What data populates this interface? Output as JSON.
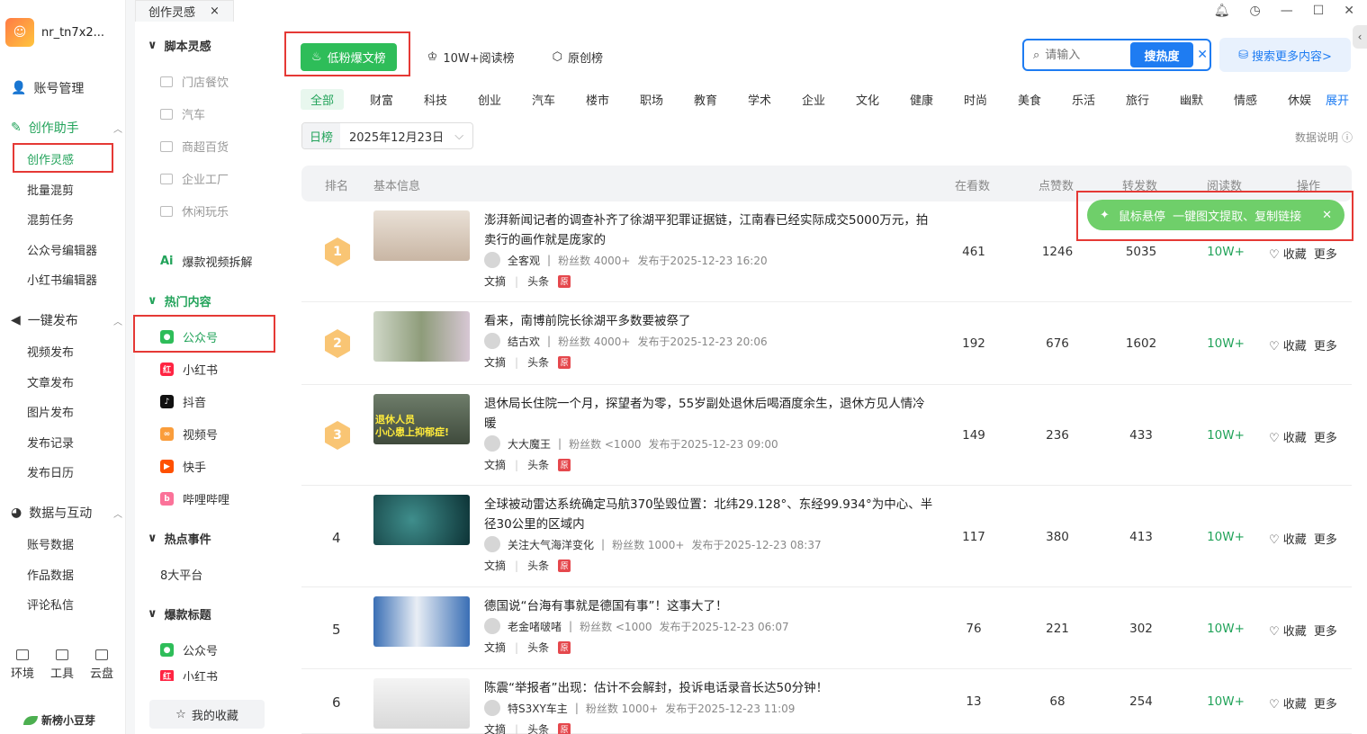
{
  "profile": {
    "name": "nr_tn7x2..."
  },
  "sidebar": {
    "account": "账号管理",
    "creation": {
      "label": "创作助手",
      "items": [
        "创作灵感",
        "批量混剪",
        "混剪任务",
        "公众号编辑器",
        "小红书编辑器"
      ]
    },
    "publish": {
      "label": "一键发布",
      "items": [
        "视频发布",
        "文章发布",
        "图片发布",
        "发布记录",
        "发布日历"
      ]
    },
    "data": {
      "label": "数据与互动",
      "items": [
        "账号数据",
        "作品数据",
        "评论私信"
      ]
    },
    "tools": [
      "环境",
      "工具",
      "云盘"
    ],
    "brand": "新榜小豆芽"
  },
  "col2": {
    "tab": "创作灵感",
    "script": {
      "label": "脚本灵感",
      "items": [
        "门店餐饮",
        "汽车",
        "商超百货",
        "企业工厂",
        "休闲玩乐"
      ]
    },
    "ai": "爆款视频拆解",
    "hot": {
      "label": "热门内容",
      "items": [
        "公众号",
        "小红书",
        "抖音",
        "视频号",
        "快手",
        "哔哩哔哩"
      ]
    },
    "events": {
      "label": "热点事件",
      "items": [
        "8大平台"
      ]
    },
    "titles": {
      "label": "爆款标题",
      "items": [
        "公众号",
        "小红书"
      ]
    },
    "favorites": "我的收藏"
  },
  "rank_tabs": [
    "低粉爆文榜",
    "10W+阅读榜",
    "原创榜"
  ],
  "search": {
    "placeholder": "请输入",
    "button": "搜热度",
    "more": "搜索更多内容>"
  },
  "categories": [
    "全部",
    "财富",
    "科技",
    "创业",
    "汽车",
    "楼市",
    "职场",
    "教育",
    "学术",
    "企业",
    "文化",
    "健康",
    "时尚",
    "美食",
    "乐活",
    "旅行",
    "幽默",
    "情感",
    "休娱"
  ],
  "expand": "展开",
  "date": {
    "label": "日榜",
    "value": "2025年12月23日"
  },
  "data_note": "数据说明",
  "table": {
    "headers": [
      "排名",
      "基本信息",
      "在看数",
      "点赞数",
      "转发数",
      "阅读数",
      "操作"
    ],
    "tag1": "文摘",
    "tag2": "头条",
    "tag3": "原",
    "fav": "收藏",
    "more": "更多",
    "rows": [
      {
        "rank": "1",
        "title": "澎湃新闻记者的调查补齐了徐湖平犯罪证据链，江南春已经实际成交5000万元，拍卖行的画作就是庞家的",
        "author": "全客观",
        "fans": "粉丝数 4000+",
        "time": "发布于2025-12-23 16:20",
        "watch": "461",
        "likes": "1246",
        "shares": "5035",
        "reads": "10W+"
      },
      {
        "rank": "2",
        "title": "看来，南博前院长徐湖平多数要被祭了",
        "author": "结古欢",
        "fans": "粉丝数 4000+",
        "time": "发布于2025-12-23 20:06",
        "watch": "192",
        "likes": "676",
        "shares": "1602",
        "reads": "10W+"
      },
      {
        "rank": "3",
        "title": "退休局长住院一个月，探望者为零，55岁副处退休后喝酒度余生，退休方见人情冷暖",
        "author": "大大魔王",
        "fans": "粉丝数 <1000",
        "time": "发布于2025-12-23 09:00",
        "watch": "149",
        "likes": "236",
        "shares": "433",
        "reads": "10W+"
      },
      {
        "rank": "4",
        "title": "全球被动雷达系统确定马航370坠毁位置：北纬29.128°、东经99.934°为中心、半径30公里的区域内",
        "author": "关注大气海洋变化",
        "fans": "粉丝数 1000+",
        "time": "发布于2025-12-23 08:37",
        "watch": "117",
        "likes": "380",
        "shares": "413",
        "reads": "10W+"
      },
      {
        "rank": "5",
        "title": "德国说“台海有事就是德国有事”！这事大了！",
        "author": "老金啫啵啫",
        "fans": "粉丝数 <1000",
        "time": "发布于2025-12-23 06:07",
        "watch": "76",
        "likes": "221",
        "shares": "302",
        "reads": "10W+"
      },
      {
        "rank": "6",
        "title": "陈震“举报者”出现：估计不会解封，投诉电话录音长达50分钟！",
        "author": "特S3XY车主",
        "fans": "粉丝数 1000+",
        "time": "发布于2025-12-23 11:09",
        "watch": "13",
        "likes": "68",
        "shares": "254",
        "reads": "10W+"
      }
    ]
  },
  "tooltip": "鼠标悬停  一键图文提取、复制链接",
  "thumb3_caption": [
    "退休人员",
    "小心患上抑郁症!"
  ],
  "colors": {
    "accent": "#22a35a",
    "blue": "#1e7cf2",
    "red_box": "#e53935"
  }
}
